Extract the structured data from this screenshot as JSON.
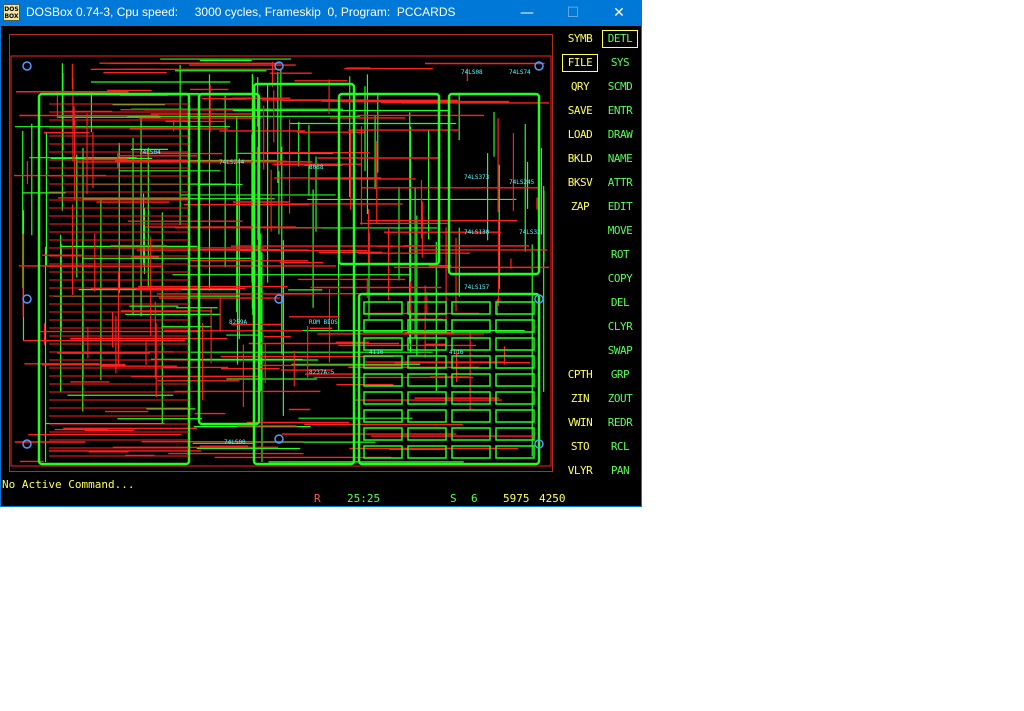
{
  "window": {
    "title": "DOSBox 0.74-3, Cpu speed:     3000 cycles, Frameskip  0, Program:  PCCARDS",
    "icon_text": "DOS BOX",
    "controls": {
      "minimize": "—",
      "maximize": "☐",
      "close": "✕"
    }
  },
  "menu": {
    "left_column": [
      "SYMB",
      "FILE",
      "QRY",
      "SAVE",
      "LOAD",
      "BKLD",
      "BKSV",
      "ZAP"
    ],
    "right_column": [
      "DETL",
      "SYS",
      "SCMD",
      "ENTR",
      "DRAW",
      "NAME",
      "ATTR",
      "EDIT",
      "MOVE",
      "ROT",
      "COPY",
      "DEL",
      "CLYR",
      "SWAP"
    ],
    "bottom_left": [
      "CPTH",
      "ZIN",
      "VWIN",
      "STO",
      "VLYR"
    ],
    "bottom_right": [
      "GRP",
      "ZOUT",
      "REDR",
      "RCL",
      "PAN"
    ],
    "active": [
      "FILE",
      "DETL"
    ]
  },
  "status": {
    "command": "No Active Command...",
    "mode": "R",
    "grid": "25:25",
    "snap": "S",
    "layer": "6",
    "x": "5975",
    "y": "4250"
  },
  "colors": {
    "background": "#000000",
    "trace_red": "#ff2020",
    "trace_green": "#20ff20",
    "text_cyan": "#55ffff",
    "menu_yellow": "#ffff55",
    "menu_green": "#55ff55",
    "frame": "#b03020",
    "titlebar": "#0078d7"
  },
  "board": {
    "chip_labels": [
      "74LS08",
      "74LS74",
      "8088",
      "74LS244",
      "74LS373",
      "74LS245",
      "74LS138",
      "74LS157",
      "ROM BIOS",
      "4116",
      "4116",
      "74LS32",
      "74LS04",
      "8259A",
      "8237A-5",
      "74LS00"
    ]
  }
}
